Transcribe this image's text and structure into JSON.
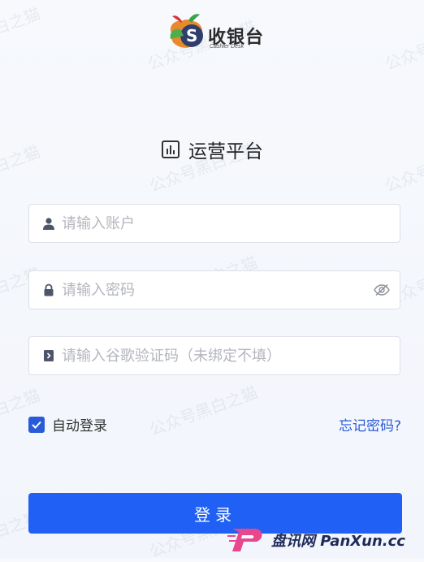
{
  "logo": {
    "brand": "收银台",
    "sub": "Cashier Desk"
  },
  "page": {
    "title": "运营平台"
  },
  "form": {
    "account_placeholder": "请输入账户",
    "password_placeholder": "请输入密码",
    "code_placeholder": "请输入谷歌验证码（未绑定不填）",
    "remember_label": "自动登录",
    "remember_checked": true,
    "forgot_label": "忘记密码?",
    "submit_label": "登录"
  },
  "watermark": {
    "text_a": "黑白之猫",
    "text_b": "公众号黑白之猫",
    "text_c": "白之猫"
  },
  "footer": {
    "site": "盘讯网 PanXun.cc"
  },
  "colors": {
    "primary": "#2060f4",
    "link": "#2a5bd7",
    "border": "#dcdfe6"
  }
}
